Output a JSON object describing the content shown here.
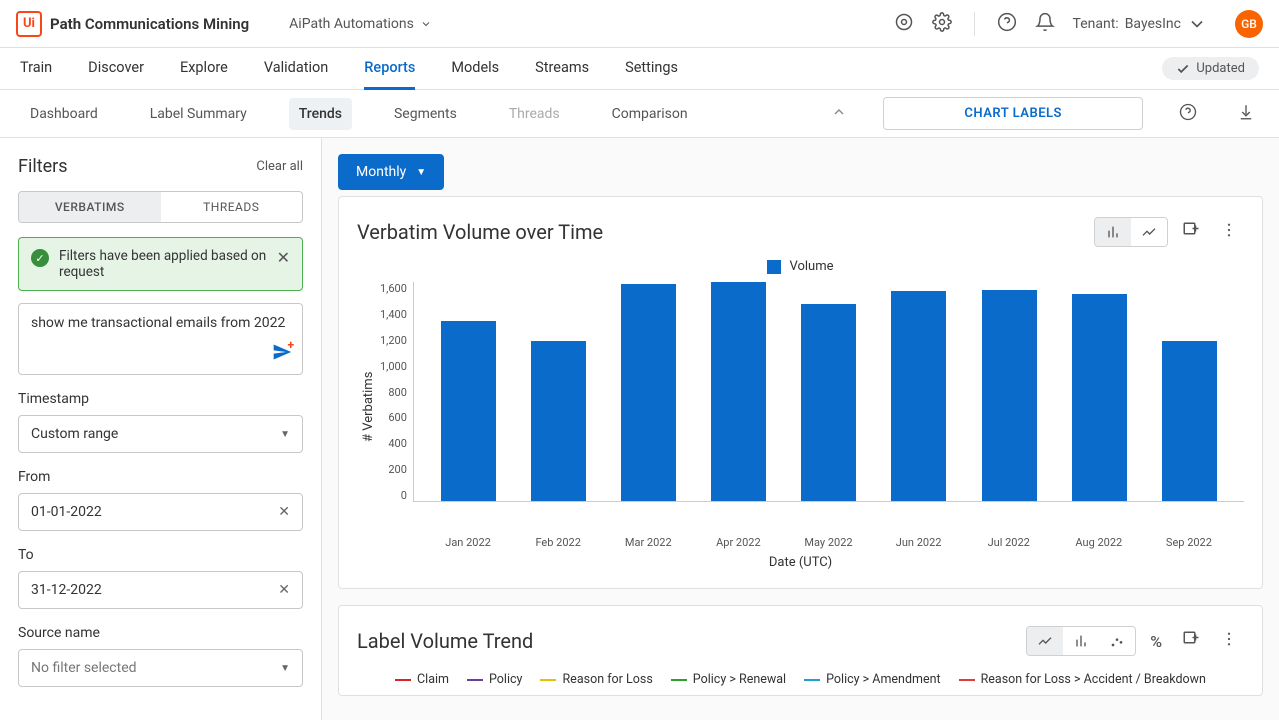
{
  "header": {
    "logo_text": "Ui",
    "product": "Communications Mining",
    "workspace": "AiPath Automations",
    "tenant_label": "Tenant:",
    "tenant_value": "BayesInc",
    "avatar": "GB"
  },
  "main_nav": {
    "items": [
      "Train",
      "Discover",
      "Explore",
      "Validation",
      "Reports",
      "Models",
      "Streams",
      "Settings"
    ],
    "active_index": 4,
    "updated_badge": "Updated"
  },
  "sub_nav": {
    "items": [
      "Dashboard",
      "Label Summary",
      "Trends",
      "Segments",
      "Threads",
      "Comparison"
    ],
    "active_index": 2,
    "faded_index": 4,
    "chart_labels_btn": "CHART LABELS"
  },
  "filters": {
    "title": "Filters",
    "clear_all": "Clear all",
    "tabs": [
      "VERBATIMS",
      "THREADS"
    ],
    "tabs_active": 0,
    "banner": "Filters have been applied based on request",
    "query": "show me transactional emails from 2022",
    "timestamp_label": "Timestamp",
    "timestamp_value": "Custom range",
    "from_label": "From",
    "from_value": "01-01-2022",
    "to_label": "To",
    "to_value": "31-12-2022",
    "source_label": "Source name",
    "source_value": "No filter selected"
  },
  "chart1": {
    "granularity": "Monthly",
    "title": "Verbatim Volume over Time",
    "legend": "Volume",
    "xlabel": "Date (UTC)",
    "ylabel": "# Verbatims"
  },
  "chart2": {
    "title": "Label Volume Trend",
    "legend": [
      {
        "name": "Claim",
        "color": "#d62728"
      },
      {
        "name": "Policy",
        "color": "#6b3fa0"
      },
      {
        "name": "Reason for Loss",
        "color": "#e6c200"
      },
      {
        "name": "Policy > Renewal",
        "color": "#2ca02c"
      },
      {
        "name": "Policy > Amendment",
        "color": "#1f9ed1"
      },
      {
        "name": "Reason for Loss > Accident / Breakdown",
        "color": "#e03a3a"
      }
    ]
  },
  "chart_data": [
    {
      "type": "bar",
      "title": "Verbatim Volume over Time",
      "xlabel": "Date (UTC)",
      "ylabel": "# Verbatims",
      "ylim": [
        0,
        1700
      ],
      "y_ticks": [
        0,
        200,
        400,
        600,
        800,
        1000,
        1200,
        1400,
        1600
      ],
      "categories": [
        "Jan 2022",
        "Feb 2022",
        "Mar 2022",
        "Apr 2022",
        "May 2022",
        "Jun 2022",
        "Jul 2022",
        "Aug 2022",
        "Sep 2022"
      ],
      "values": [
        1390,
        1240,
        1680,
        1690,
        1520,
        1620,
        1630,
        1600,
        1240
      ],
      "legend": [
        "Volume"
      ],
      "color": "#0b6bcb"
    },
    {
      "type": "line",
      "title": "Label Volume Trend",
      "series": [
        {
          "name": "Claim",
          "color": "#d62728"
        },
        {
          "name": "Policy",
          "color": "#6b3fa0"
        },
        {
          "name": "Reason for Loss",
          "color": "#e6c200"
        },
        {
          "name": "Policy > Renewal",
          "color": "#2ca02c"
        },
        {
          "name": "Policy > Amendment",
          "color": "#1f9ed1"
        },
        {
          "name": "Reason for Loss > Accident / Breakdown",
          "color": "#e03a3a"
        }
      ]
    }
  ]
}
